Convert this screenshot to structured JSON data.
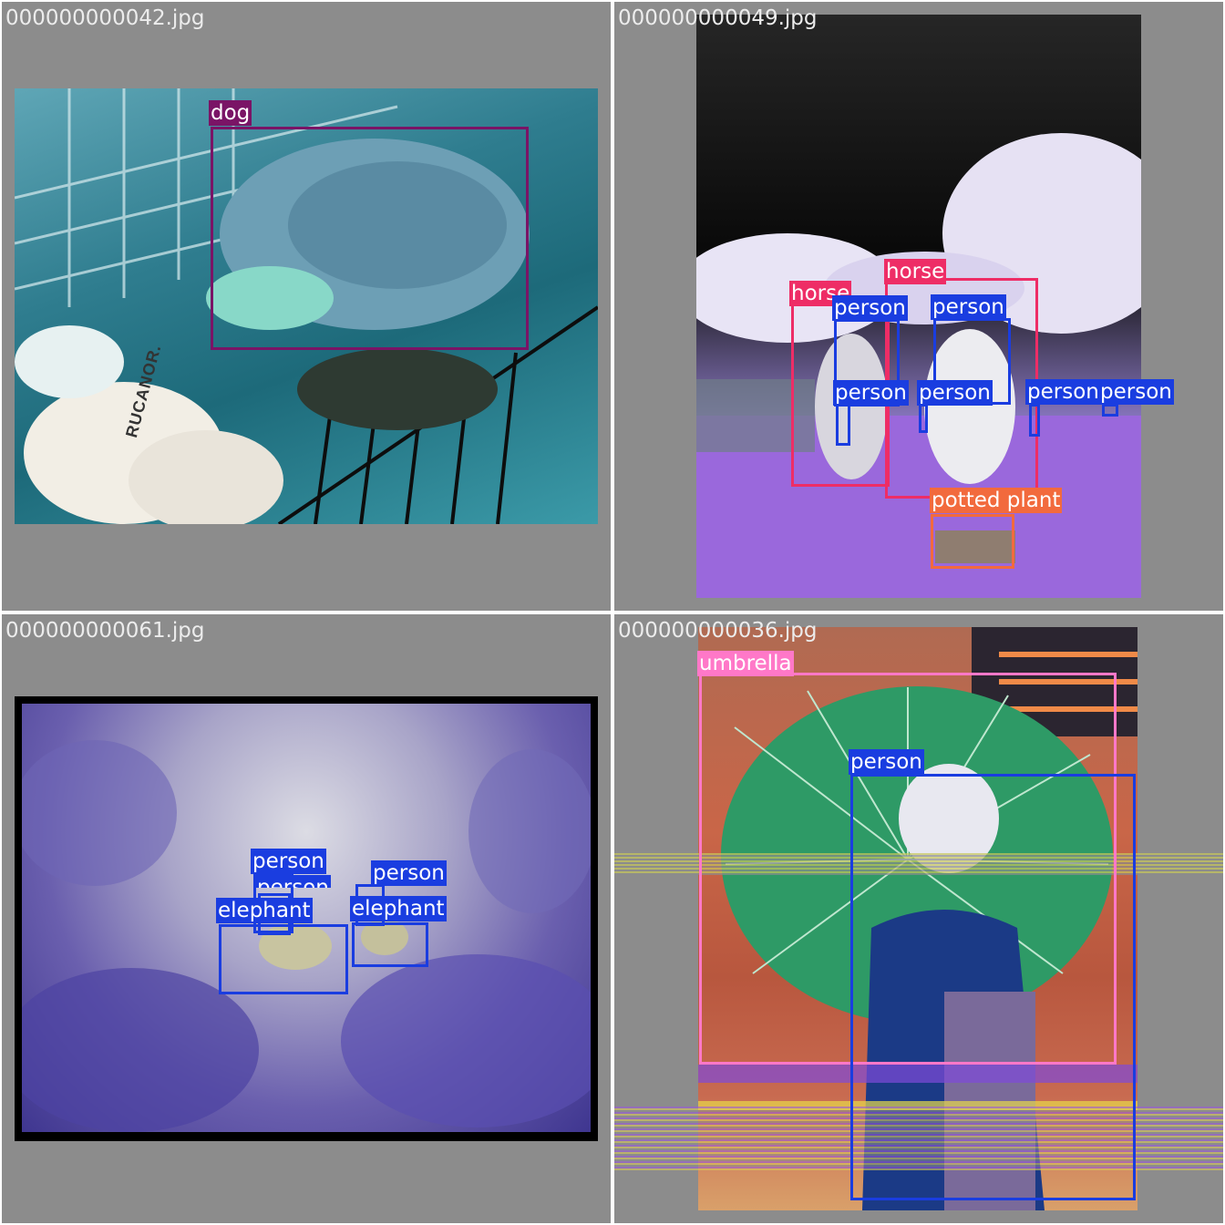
{
  "panels": [
    {
      "filename": "000000000042.jpg",
      "photo_text": "RUCANOR.",
      "detections": [
        {
          "label": "dog",
          "color": "#7a1466"
        }
      ]
    },
    {
      "filename": "000000000049.jpg",
      "detections": [
        {
          "label": "horse",
          "color": "#ee2d66"
        },
        {
          "label": "horse",
          "color": "#ee2d66"
        },
        {
          "label": "person",
          "color": "#1a3de0"
        },
        {
          "label": "person",
          "color": "#1a3de0"
        },
        {
          "label": "person",
          "color": "#1a3de0"
        },
        {
          "label": "person",
          "color": "#1a3de0"
        },
        {
          "label": "person",
          "color": "#1a3de0"
        },
        {
          "label": "person",
          "color": "#1a3de0"
        },
        {
          "label": "potted plant",
          "color": "#f26a3d"
        }
      ]
    },
    {
      "filename": "000000000061.jpg",
      "detections": [
        {
          "label": "person",
          "color": "#1a3de0"
        },
        {
          "label": "person",
          "color": "#1a3de0"
        },
        {
          "label": "person",
          "color": "#1a3de0"
        },
        {
          "label": "elephant",
          "color": "#1a3de0"
        },
        {
          "label": "elephant",
          "color": "#1a3de0"
        }
      ]
    },
    {
      "filename": "000000000036.jpg",
      "detections": [
        {
          "label": "umbrella",
          "color": "#ff78c8"
        },
        {
          "label": "person",
          "color": "#1a3de0"
        }
      ]
    }
  ]
}
